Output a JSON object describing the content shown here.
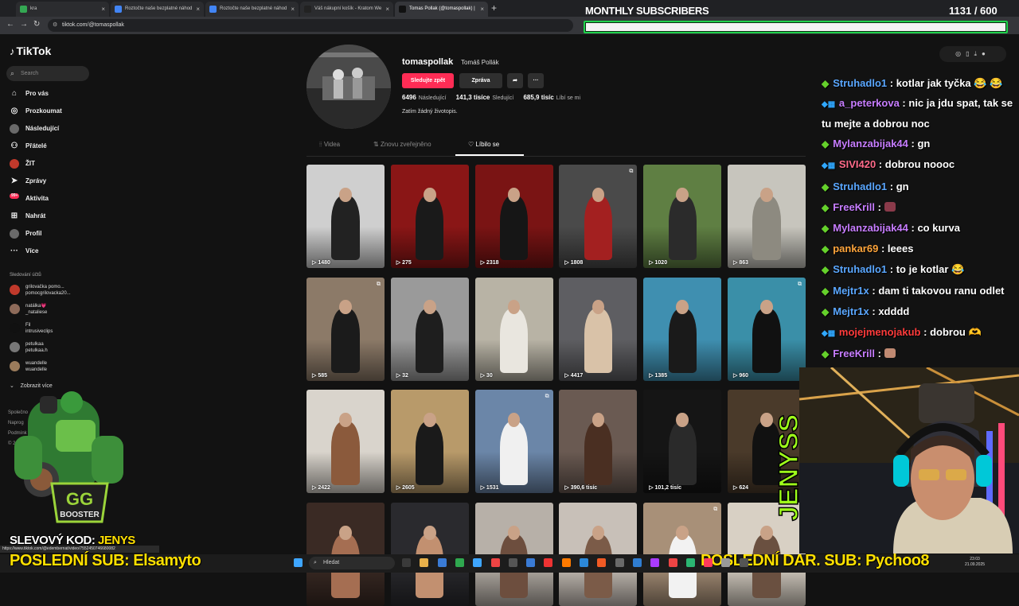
{
  "browser": {
    "tabs": [
      {
        "label": "kra",
        "active": false,
        "color": "#34a853"
      },
      {
        "label": "Roztočte naše bezplatné náhod",
        "active": false,
        "color": "#4285f4"
      },
      {
        "label": "Roztočte naše bezplatné náhod",
        "active": false,
        "color": "#4285f4"
      },
      {
        "label": "Váš nákupní košík - Kratom We",
        "active": false,
        "color": "#222222"
      },
      {
        "label": "Tomas Pollak (@tomaspollak) |",
        "active": true,
        "color": "#111111"
      }
    ],
    "new_tab": "+",
    "url": "tiktok.com/@tomaspollak"
  },
  "tiktok": {
    "brand": "TikTok",
    "search_placeholder": "Search",
    "nav": [
      {
        "label": "Pro vás",
        "icon": "home-icon",
        "glyph": "⌂"
      },
      {
        "label": "Prozkoumat",
        "icon": "compass-icon",
        "glyph": "◎"
      },
      {
        "label": "Následující",
        "icon": "following-avatar-icon",
        "glyph": ""
      },
      {
        "label": "Přátelé",
        "icon": "friends-icon",
        "glyph": "⚇"
      },
      {
        "label": "ŽIT",
        "icon": "live-avatar-icon",
        "glyph": ""
      },
      {
        "label": "Zprávy",
        "icon": "paper-plane-icon",
        "glyph": "➤"
      },
      {
        "label": "Aktivita",
        "icon": "activity-badge-icon",
        "glyph": "",
        "badge": "99+"
      },
      {
        "label": "Nahrát",
        "icon": "upload-plus-icon",
        "glyph": "⊞"
      },
      {
        "label": "Profil",
        "icon": "profile-avatar-icon",
        "glyph": ""
      },
      {
        "label": "Více",
        "icon": "more-dots-icon",
        "glyph": "···"
      }
    ],
    "followed_title": "Sledování účtů",
    "followed": [
      {
        "line1": "grilovačka pomo...",
        "line2": "pomocgrilovacka20...",
        "color": "#c0392b"
      },
      {
        "line1": "natálka💗",
        "line2": "_nataliese",
        "color": "#8e6b5a"
      },
      {
        "line1": "Fil",
        "line2": "intrusiveclips",
        "color": "#111111"
      },
      {
        "line1": "petulkaa",
        "line2": "petulkaa.h",
        "color": "#777777"
      },
      {
        "line1": "wuandelle",
        "line2": "wuandelle",
        "color": "#9a7b5b"
      }
    ],
    "show_more": "Zobrazit více",
    "footer": [
      "Společno",
      "Naprog",
      "Podmínk",
      "© 2025 TikTo"
    ]
  },
  "profile": {
    "username": "tomaspollak",
    "display_name": "Tomáš Pollák",
    "follow_button": "Sledujte zpět",
    "message_button": "Zpráva",
    "share_icon": "share-arrow-icon",
    "more_icon": "ellipsis-icon",
    "following_count": "6496",
    "following_label": "Následující",
    "followers_count": "141,3 tisíce",
    "followers_label": "Sledující",
    "likes_count": "685,9 tisíc",
    "likes_label": "Líbí se mi",
    "bio": "Zatím žádný životopis.",
    "tabs": [
      {
        "label": "Videa",
        "icon": "grid-icon",
        "glyph": "⦙⦙"
      },
      {
        "label": "Znovu zveřejněno",
        "icon": "repost-icon",
        "glyph": "⇅"
      },
      {
        "label": "Líbilo se",
        "icon": "heart-outline-icon",
        "glyph": "♡",
        "active": true
      }
    ]
  },
  "videos": [
    {
      "views": "1480",
      "bg": "#cfcfcf",
      "fig": "#222222",
      "pin": false
    },
    {
      "views": "275",
      "bg": "#8a1616",
      "fig": "#1a1a1a",
      "pin": false
    },
    {
      "views": "2318",
      "bg": "#7a1414",
      "fig": "#161616",
      "pin": false
    },
    {
      "views": "1808",
      "bg": "#4a4a4a",
      "fig": "#a32020",
      "pin": true
    },
    {
      "views": "1020",
      "bg": "#5f7f43",
      "fig": "#2b2b2b",
      "pin": false
    },
    {
      "views": "863",
      "bg": "#c7c5bd",
      "fig": "#8d8a80",
      "pin": false
    },
    {
      "views": "585",
      "bg": "#8c7a68",
      "fig": "#1b1b1b",
      "pin": true
    },
    {
      "views": "32",
      "bg": "#9a9a9a",
      "fig": "#1e1e1e",
      "pin": false
    },
    {
      "views": "30",
      "bg": "#b8b3a5",
      "fig": "#e9e6df",
      "pin": false
    },
    {
      "views": "4417",
      "bg": "#5e5e62",
      "fig": "#d9c2a8",
      "pin": false
    },
    {
      "views": "1385",
      "bg": "#3f8fb0",
      "fig": "#1a1a1a",
      "pin": false
    },
    {
      "views": "960",
      "bg": "#3a8fa8",
      "fig": "#111111",
      "pin": true
    },
    {
      "views": "2422",
      "bg": "#d9d4cc",
      "fig": "#8b5a3c",
      "pin": false
    },
    {
      "views": "2605",
      "bg": "#b89a6a",
      "fig": "#1a1a1a",
      "pin": false
    },
    {
      "views": "1531",
      "bg": "#6b86a8",
      "fig": "#f0f0f0",
      "pin": true
    },
    {
      "views": "390,6 tisíc",
      "bg": "#6a5a52",
      "fig": "#4a2f22",
      "pin": false
    },
    {
      "views": "101,2 tisíc",
      "bg": "#151515",
      "fig": "#2a2a2a",
      "pin": false
    },
    {
      "views": "624",
      "bg": "#4a3a2a",
      "fig": "#111111",
      "pin": false
    },
    {
      "views": "",
      "bg": "#3a2a24",
      "fig": "#a56e52",
      "pin": false
    },
    {
      "views": "",
      "bg": "#2a2a2e",
      "fig": "#c29070",
      "pin": false
    },
    {
      "views": "",
      "bg": "#b7b0a8",
      "fig": "#6d4e3e",
      "pin": false
    },
    {
      "views": "",
      "bg": "#c8c0b8",
      "fig": "#7b5b48",
      "pin": false
    },
    {
      "views": "",
      "bg": "#a89078",
      "fig": "#f2f2f2",
      "pin": true
    },
    {
      "views": "",
      "bg": "#d8d0c4",
      "fig": "#6a5040",
      "pin": false
    }
  ],
  "subs_goal": {
    "title": "MONTHLY SUBSCRIBERS",
    "count": "1131 / 600",
    "progress": 1.0
  },
  "chat": [
    {
      "user": "Struhadlo1",
      "color": "#5aa7ff",
      "badge": "diamond",
      "text": "kotlar jak tyčka 😂 😂"
    },
    {
      "user": "a_peterkova",
      "color": "#c77dff",
      "badge": "cube",
      "text": "nic ja jdu spat, tak se tu mejte a dobrou noc",
      "wrap": true
    },
    {
      "user": "Mylanzabijak44",
      "color": "#c77dff",
      "badge": "diamond",
      "text": "gn"
    },
    {
      "user": "SIVI420",
      "color": "#ff6b8a",
      "badge": "cube",
      "text": "dobrou noooc"
    },
    {
      "user": "Struhadlo1",
      "color": "#5aa7ff",
      "badge": "diamond",
      "text": "gn"
    },
    {
      "user": "FreeKrill",
      "color": "#c77dff",
      "badge": "diamond",
      "text": "",
      "emote": "#8a3a4a"
    },
    {
      "user": "Mylanzabijak44",
      "color": "#c77dff",
      "badge": "diamond",
      "text": "co kurva"
    },
    {
      "user": "pankar69",
      "color": "#ffa53b",
      "badge": "diamond",
      "text": "leees"
    },
    {
      "user": "Struhadlo1",
      "color": "#5aa7ff",
      "badge": "diamond",
      "text": "to je kotlar 😂"
    },
    {
      "user": "Mejtr1x",
      "color": "#5aa7ff",
      "badge": "diamond",
      "text": "dam ti takovou ranu odlet"
    },
    {
      "user": "Mejtr1x",
      "color": "#5aa7ff",
      "badge": "diamond",
      "text": "xdddd"
    },
    {
      "user": "mojejmenojakub",
      "color": "#ff3b3b",
      "badge": "cube",
      "text": "dobrou 🫶"
    },
    {
      "user": "FreeKrill",
      "color": "#c77dff",
      "badge": "diamond",
      "text": "",
      "emote": "#c08a72"
    },
    {
      "user": "FreeKrill",
      "color": "#c77dff",
      "badge": "diamond",
      "text": "",
      "emote": "#5a8a3a"
    }
  ],
  "overlay": {
    "promo_prefix": "SLEVOVÝ KOD:",
    "promo_code": "JENYS",
    "booster_label": "BOOSTER",
    "streamer_name": "JENYSS",
    "last_sub": "POSLEDNÍ SUB: Elsamyto",
    "last_dar_sub": "POSLEDNÍ DAR. SUB: Pychoo8",
    "status_url": "https://www.tiktok.com/@edembernat/video/7552450746680082"
  },
  "taskbar": {
    "search_placeholder": "Hledat",
    "time": "23:03",
    "date": "21.09.2025"
  },
  "colors": {
    "tiktok_pink": "#fe2c55",
    "goal_green": "#1fd14b",
    "overlay_yellow": "#ffe000"
  }
}
